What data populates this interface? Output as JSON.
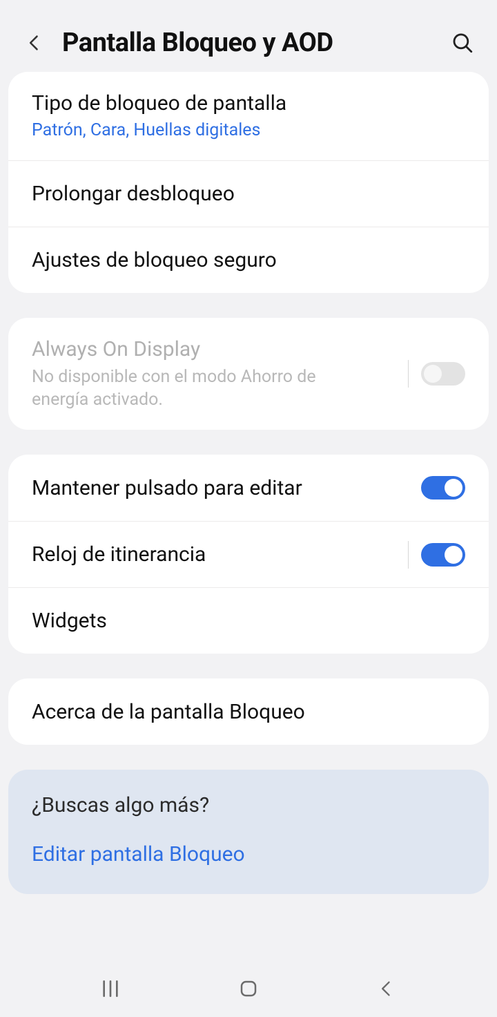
{
  "header": {
    "title": "Pantalla Bloqueo y AOD"
  },
  "group1": {
    "lockType": {
      "title": "Tipo de bloqueo de pantalla",
      "subtitle": "Patrón, Cara, Huellas digitales"
    },
    "extendUnlock": {
      "title": "Prolongar desbloqueo"
    },
    "secureLock": {
      "title": "Ajustes de bloqueo seguro"
    }
  },
  "aod": {
    "title": "Always On Display",
    "subtitle": "No disponible con el modo Ahorro de energía activado.",
    "enabled": false
  },
  "group3": {
    "holdToEdit": {
      "title": "Mantener pulsado para editar",
      "enabled": true
    },
    "roamingClock": {
      "title": "Reloj de itinerancia",
      "enabled": true
    },
    "widgets": {
      "title": "Widgets"
    }
  },
  "about": {
    "title": "Acerca de la pantalla Bloqueo"
  },
  "suggestion": {
    "question": "¿Buscas algo más?",
    "link": "Editar pantalla Bloqueo"
  }
}
